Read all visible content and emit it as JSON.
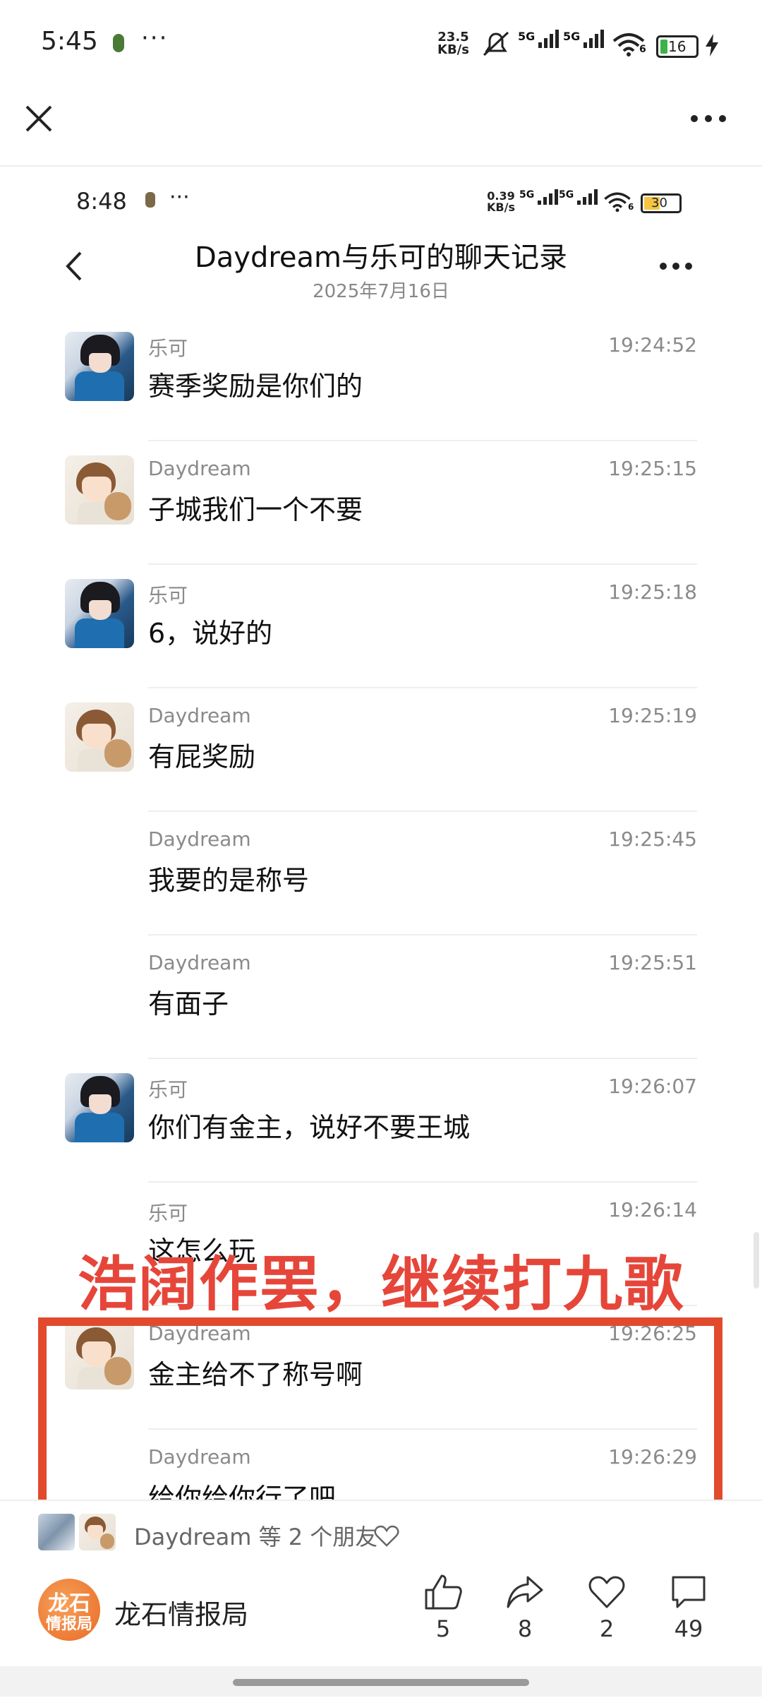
{
  "status_bar": {
    "time": "5:45",
    "dots": "···",
    "speed_top": "23.5",
    "speed_bottom": "KB/s",
    "network_1": "5G",
    "network_2": "5G",
    "wifi_level": "6",
    "battery": "16"
  },
  "inner_status_bar": {
    "time": "8:48",
    "dots": "···",
    "speed_top": "0.39",
    "speed_bottom": "KB/s",
    "network_1": "5G",
    "network_2": "5G",
    "wifi_level": "6",
    "battery": "30"
  },
  "chat": {
    "title": "Daydream与乐可的聊天记录",
    "date": "2025年7月16日",
    "messages": [
      {
        "sender": "乐可",
        "time": "19:24:52",
        "text": "赛季奖励是你们的",
        "avatar": "leke"
      },
      {
        "sender": "Daydream",
        "time": "19:25:15",
        "text": "子城我们一个不要",
        "avatar": "daydream"
      },
      {
        "sender": "乐可",
        "time": "19:25:18",
        "text": "6，说好的",
        "avatar": "leke"
      },
      {
        "sender": "Daydream",
        "time": "19:25:19",
        "text": "有屁奖励",
        "avatar": "daydream"
      },
      {
        "sender": "Daydream",
        "time": "19:25:45",
        "text": "我要的是称号",
        "avatar": ""
      },
      {
        "sender": "Daydream",
        "time": "19:25:51",
        "text": "有面子",
        "avatar": ""
      },
      {
        "sender": "乐可",
        "time": "19:26:07",
        "text": "你们有金主，说好不要王城",
        "avatar": "leke"
      },
      {
        "sender": "乐可",
        "time": "19:26:14",
        "text": "这怎么玩",
        "avatar": ""
      },
      {
        "sender": "Daydream",
        "time": "19:26:25",
        "text": "金主给不了称号啊",
        "avatar": "daydream"
      },
      {
        "sender": "Daydream",
        "time": "19:26:29",
        "text": "给你给你行了吧",
        "avatar": ""
      }
    ]
  },
  "overlay": {
    "banner_text": "浩阔作罢，继续打九歌",
    "accent_color": "#e24a2e"
  },
  "social": {
    "friends_text": "Daydream 等 2 个朋友",
    "account_name": "龙石情报局",
    "logo_line1": "龙石",
    "logo_line2": "情报局",
    "actions": [
      {
        "icon": "thumbs-up-icon",
        "count": "5"
      },
      {
        "icon": "share-icon",
        "count": "8"
      },
      {
        "icon": "heart-icon",
        "count": "2"
      },
      {
        "icon": "comment-icon",
        "count": "49"
      }
    ]
  }
}
